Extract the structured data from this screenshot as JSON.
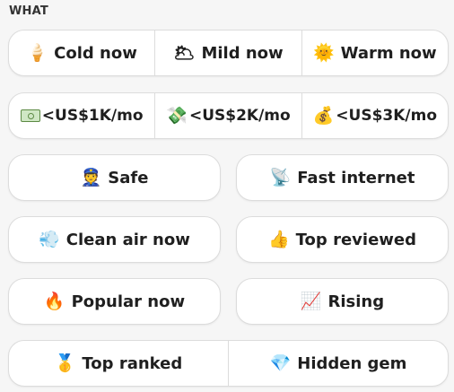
{
  "section": {
    "label": "WHAT"
  },
  "filters": {
    "weather": [
      {
        "icon": "🍦",
        "label": "Cold now"
      },
      {
        "icon": "🌥",
        "label": "Mild now"
      },
      {
        "icon": "🌞",
        "label": "Warm now"
      }
    ],
    "cost": [
      {
        "icon": "",
        "label": "<US$1K/mo"
      },
      {
        "icon": "💸",
        "label": "<US$2K/mo"
      },
      {
        "icon": "💰",
        "label": "<US$3K/mo"
      }
    ],
    "safe": {
      "icon": "👮",
      "label": "Safe"
    },
    "fast_internet": {
      "icon": "📡",
      "label": "Fast internet"
    },
    "clean_air": {
      "icon": "💨",
      "label": "Clean air now"
    },
    "top_reviewed": {
      "icon": "👍",
      "label": "Top reviewed"
    },
    "popular": {
      "icon": "🔥",
      "label": "Popular now"
    },
    "rising": {
      "icon": "📈",
      "label": "Rising"
    },
    "top_ranked": {
      "icon": "🥇",
      "label": "Top ranked"
    },
    "hidden_gem": {
      "icon": "💎",
      "label": "Hidden gem"
    }
  }
}
